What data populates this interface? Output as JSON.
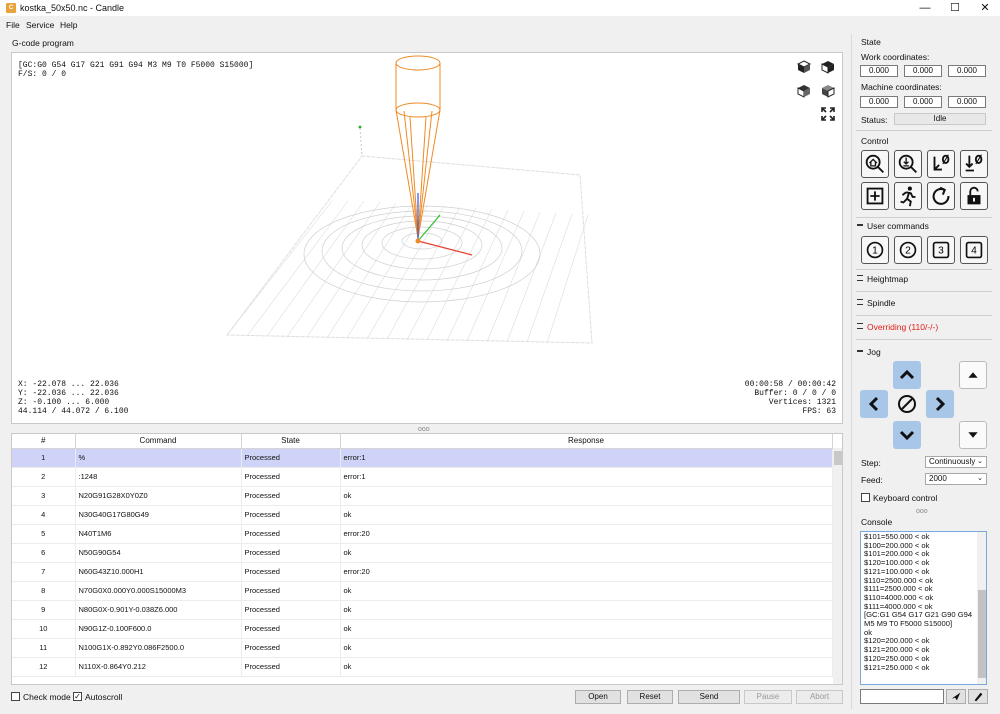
{
  "window": {
    "title": "kostka_50x50.nc - Candle",
    "minimize": "—",
    "maximize": "☐",
    "close": "✕"
  },
  "menu": [
    "File",
    "Service",
    "Help"
  ],
  "gcode_panel": {
    "label": "G-code program",
    "overlay_top": [
      "[GC:G0 G54 G17 G21 G91 G94 M3 M9 T0 F5000 S15000]",
      "F/S: 0 / 0"
    ],
    "overlay_bottom_left": [
      "X: -22.078 ... 22.036",
      "Y: -22.036 ... 22.036",
      "Z: -0.100 ... 6.000",
      "44.114 / 44.072 / 6.100"
    ],
    "overlay_bottom_right": [
      "00:00:58 / 00:00:42",
      "Buffer: 0 / 0 / 0",
      "Vertices: 1321",
      "FPS: 63"
    ]
  },
  "table": {
    "headers": [
      "#",
      "Command",
      "State",
      "Response"
    ],
    "rows": [
      [
        "1",
        "%",
        "Processed",
        "error:1"
      ],
      [
        "2",
        ":1248",
        "Processed",
        "error:1"
      ],
      [
        "3",
        "N20G91G28X0Y0Z0",
        "Processed",
        "ok"
      ],
      [
        "4",
        "N30G40G17G80G49",
        "Processed",
        "ok"
      ],
      [
        "5",
        "N40T1M6",
        "Processed",
        "error:20"
      ],
      [
        "6",
        "N50G90G54",
        "Processed",
        "ok"
      ],
      [
        "7",
        "N60G43Z10.000H1",
        "Processed",
        "error:20"
      ],
      [
        "8",
        "N70G0X0.000Y0.000S15000M3",
        "Processed",
        "ok"
      ],
      [
        "9",
        "N80G0X-0.901Y-0.038Z6.000",
        "Processed",
        "ok"
      ],
      [
        "10",
        "N90G1Z-0.100F600.0",
        "Processed",
        "ok"
      ],
      [
        "11",
        "N100G1X-0.892Y0.086F2500.0",
        "Processed",
        "ok"
      ],
      [
        "12",
        "N110X-0.864Y0.212",
        "Processed",
        "ok"
      ]
    ]
  },
  "bottom": {
    "check_mode": "Check mode",
    "autoscroll": "Autoscroll",
    "open": "Open",
    "reset": "Reset",
    "send": "Send",
    "pause": "Pause",
    "abort": "Abort"
  },
  "state": {
    "label": "State",
    "work_label": "Work coordinates:",
    "work": [
      "0.000",
      "0.000",
      "0.000"
    ],
    "machine_label": "Machine coordinates:",
    "machine": [
      "0.000",
      "0.000",
      "0.000"
    ],
    "status_label": "Status:",
    "status": "Idle"
  },
  "control": {
    "label": "Control"
  },
  "user_commands": {
    "label": "User commands",
    "buttons": [
      "1",
      "2",
      "3",
      "4"
    ]
  },
  "heightmap": {
    "label": "Heightmap"
  },
  "spindle": {
    "label": "Spindle"
  },
  "overriding": {
    "label": "Overriding (110/-/-)",
    "color": "#e0201a"
  },
  "jog": {
    "label": "Jog",
    "step_label": "Step:",
    "step_value": "Continuously",
    "feed_label": "Feed:",
    "feed_value": "2000",
    "keyboard": "Keyboard control"
  },
  "console": {
    "label": "Console",
    "text": "$101=550.000 < ok\n$100=200.000 < ok\n$101=200.000 < ok\n$120=100.000 < ok\n$121=100.000 < ok\n$110=2500.000 < ok\n$111=2500.000 < ok\n$110=4000.000 < ok\n$111=4000.000 < ok\n[GC:G1 G54 G17 G21 G90 G94 M5 M9 T0 F5000 S15000]\nok\n$120=200.000 < ok\n$121=200.000 < ok\n$120=250.000 < ok\n$121=250.000 < ok"
  },
  "colors": {
    "accent": "#7fa7dc",
    "selected_row": "#cfd3f7",
    "toolpath": "#d9d9d9",
    "tool": "#f08a24",
    "jog_blue": "#a8c6e8"
  }
}
